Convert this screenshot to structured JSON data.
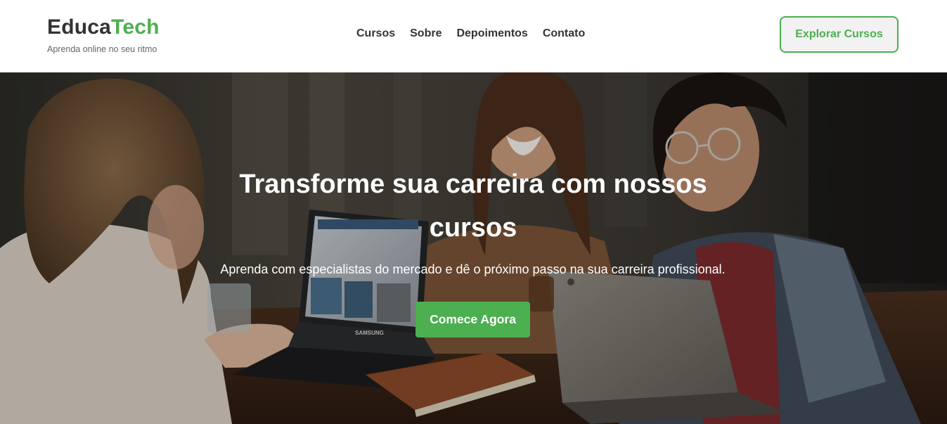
{
  "header": {
    "brand_primary": "Educa",
    "brand_accent": "Tech",
    "tagline": "Aprenda online no seu ritmo",
    "nav": [
      {
        "label": "Cursos"
      },
      {
        "label": "Sobre"
      },
      {
        "label": "Depoimentos"
      },
      {
        "label": "Contato"
      }
    ],
    "explore_button": "Explorar Cursos"
  },
  "hero": {
    "title": "Transforme sua carreira com nossos cursos",
    "subtitle": "Aprenda com especialistas do mercado e dê o próximo passo na sua carreira profissional.",
    "cta_button": "Comece Agora",
    "laptop_brand_front": "SAMSUNG"
  },
  "colors": {
    "accent": "#4caf50",
    "text_dark": "#333333",
    "text_muted": "#666666",
    "header_bg": "#ffffff",
    "button_bg": "#f2f2f2"
  }
}
